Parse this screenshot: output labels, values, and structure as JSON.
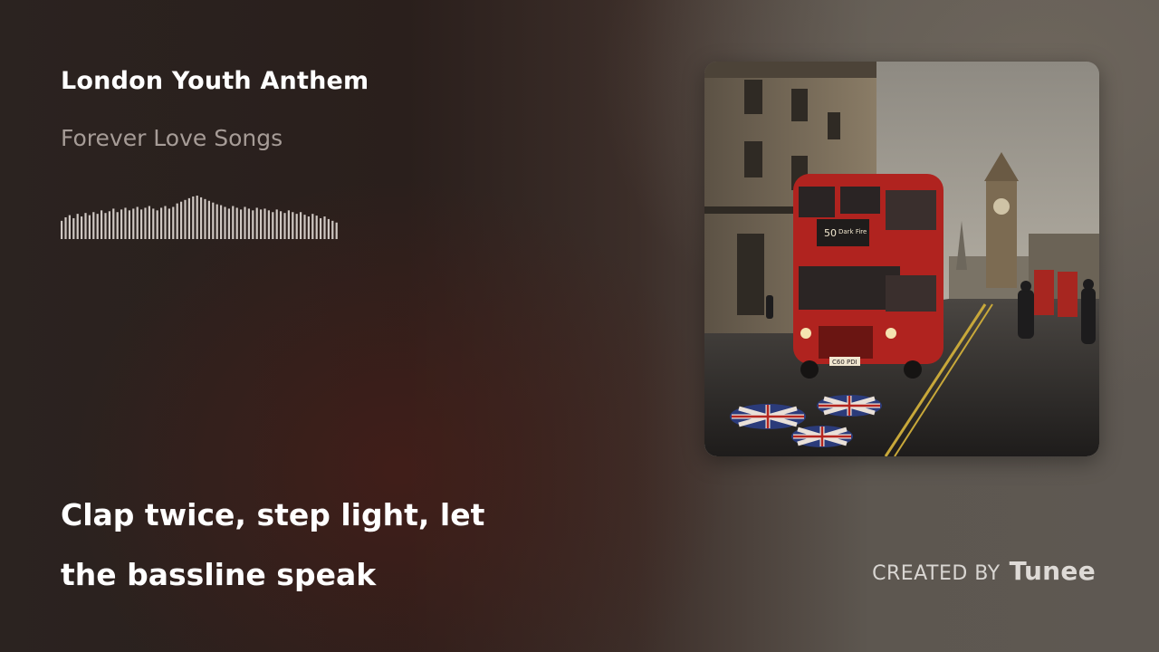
{
  "track": {
    "title": "London Youth Anthem",
    "album": "Forever Love Songs"
  },
  "waveform": {
    "levels": [
      0.42,
      0.5,
      0.55,
      0.48,
      0.58,
      0.52,
      0.6,
      0.55,
      0.62,
      0.58,
      0.66,
      0.6,
      0.64,
      0.7,
      0.62,
      0.68,
      0.72,
      0.66,
      0.7,
      0.74,
      0.68,
      0.72,
      0.76,
      0.7,
      0.66,
      0.72,
      0.76,
      0.7,
      0.74,
      0.82,
      0.86,
      0.9,
      0.94,
      0.98,
      1.0,
      0.96,
      0.92,
      0.88,
      0.84,
      0.8,
      0.78,
      0.74,
      0.7,
      0.76,
      0.72,
      0.68,
      0.74,
      0.7,
      0.66,
      0.72,
      0.68,
      0.7,
      0.66,
      0.62,
      0.68,
      0.64,
      0.6,
      0.66,
      0.62,
      0.58,
      0.62,
      0.56,
      0.52,
      0.58,
      0.54,
      0.48,
      0.52,
      0.46,
      0.42,
      0.38
    ]
  },
  "lyrics": {
    "line1": "Clap twice, step light, let",
    "line2": "the bassline speak"
  },
  "cover": {
    "bus_route": "50",
    "bus_destination": "Dark Fire",
    "plate": "C60 PDI"
  },
  "credit": {
    "label": "CREATED BY",
    "brand": "Tunee"
  },
  "colors": {
    "bus_red": "#b0231f",
    "wave": "#cfc7c2",
    "album_text": "#a69c97"
  }
}
